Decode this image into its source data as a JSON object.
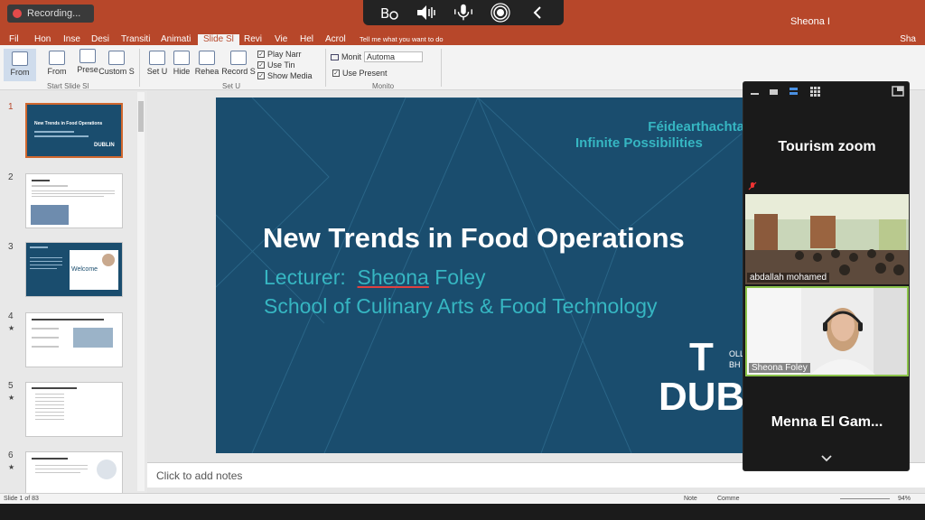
{
  "recording": {
    "label": "Recording..."
  },
  "zoom_controls": [
    "share-audio-icon",
    "speaker-icon",
    "microphone-icon",
    "live-transcript-icon",
    "collapse-icon"
  ],
  "titlebar": {
    "user": "Sheona I"
  },
  "ribbon_tabs": [
    "Fil",
    "Hon",
    "Inse",
    "Desi",
    "Transiti",
    "Animati",
    "Slide Sl",
    "Revi",
    "Vie",
    "Hel",
    "Acrol"
  ],
  "active_tab": "Slide Sl",
  "tell_me": "Tell me what you want to do",
  "share": "Sha",
  "ribbon": {
    "btn_from_beginning": "From",
    "btn_from_current": "From",
    "btn_present_online": "Prese",
    "btn_custom": "Custom S",
    "group_start": "Start Slide Sl",
    "btn_setup": "Set U",
    "btn_hide": "Hide",
    "btn_rehearse": "Rehea",
    "btn_record": "Record S",
    "chk_narrations": "Play Narr",
    "chk_timings": "Use Tin",
    "chk_media": "Show Media",
    "group_setup": "Set U",
    "monitor_label": "Monit",
    "monitor_value": "Automa",
    "chk_presenter": "Use Present",
    "group_monitors": "Monito"
  },
  "thumbnails": [
    {
      "num": "1",
      "star": "",
      "active": true
    },
    {
      "num": "2",
      "star": "",
      "active": false
    },
    {
      "num": "3",
      "star": "",
      "active": false
    },
    {
      "num": "4",
      "star": "★",
      "active": false
    },
    {
      "num": "5",
      "star": "★",
      "active": false
    },
    {
      "num": "6",
      "star": "★",
      "active": false
    }
  ],
  "thumb_text": {
    "t1_title": "New Trends in Food Operations",
    "t1_logo": "DUBLIN",
    "t3_welcome": "Welcome"
  },
  "slide": {
    "tagline_irish": "Féidearthachta",
    "tagline_english": "Infinite Possibilities",
    "title": "New Trends in Food Operations",
    "lecturer_label": "Lecturer:",
    "lecturer_name": "Sheona",
    "lecturer_surname": "Foley",
    "school": "School of Culinary Arts & Food Technology",
    "logo_top": "T",
    "logo_bottom": "DUB",
    "logo_small_1": "OLL",
    "logo_small_2": "BH"
  },
  "notes": {
    "placeholder": "Click to add notes"
  },
  "statusbar": {
    "slide_info": "Slide 1 of 83",
    "notes": "Note",
    "comments": "Comme",
    "zoom": "94%"
  },
  "zoom_panel": {
    "title": "Tourism zoom",
    "participant_1": "abdallah mohamed",
    "participant_2": "Sheona Foley",
    "participant_3": "Menna El Gam..."
  }
}
